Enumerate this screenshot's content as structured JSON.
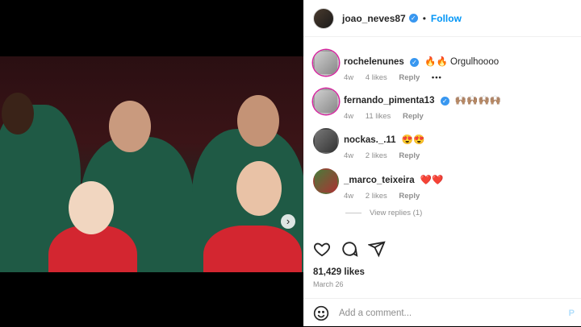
{
  "post": {
    "author": "joao_neves87",
    "follow_label": "Follow",
    "separator": "•"
  },
  "comments": [
    {
      "user": "rochelenunes",
      "text": "🔥🔥 Orgulhoooo",
      "age": "4w",
      "likes": "4 likes",
      "reply": "Reply",
      "more": "•••"
    },
    {
      "user": "fernando_pimenta13",
      "text": "🙌🏽🙌🏽🙌🏽🙌🏽",
      "age": "4w",
      "likes": "11 likes",
      "reply": "Reply"
    },
    {
      "user": "nockas._.11",
      "text": "😍😍",
      "age": "4w",
      "likes": "2 likes",
      "reply": "Reply"
    },
    {
      "user": "_marco_teixeira",
      "text": "❤️❤️",
      "age": "4w",
      "likes": "2 likes",
      "reply": "Reply"
    }
  ],
  "view_replies": "View replies (1)",
  "likes_count": "81,429 likes",
  "date": "March 26",
  "add_comment_placeholder": "Add a comment...",
  "post_button": "P",
  "icons": [
    "heart-icon",
    "comment-icon",
    "share-icon",
    "emoji-icon",
    "next-arrow-icon"
  ],
  "colors": {
    "accent": "#0095f6",
    "verified": "#3897f0",
    "muted": "#8e8e8e"
  }
}
